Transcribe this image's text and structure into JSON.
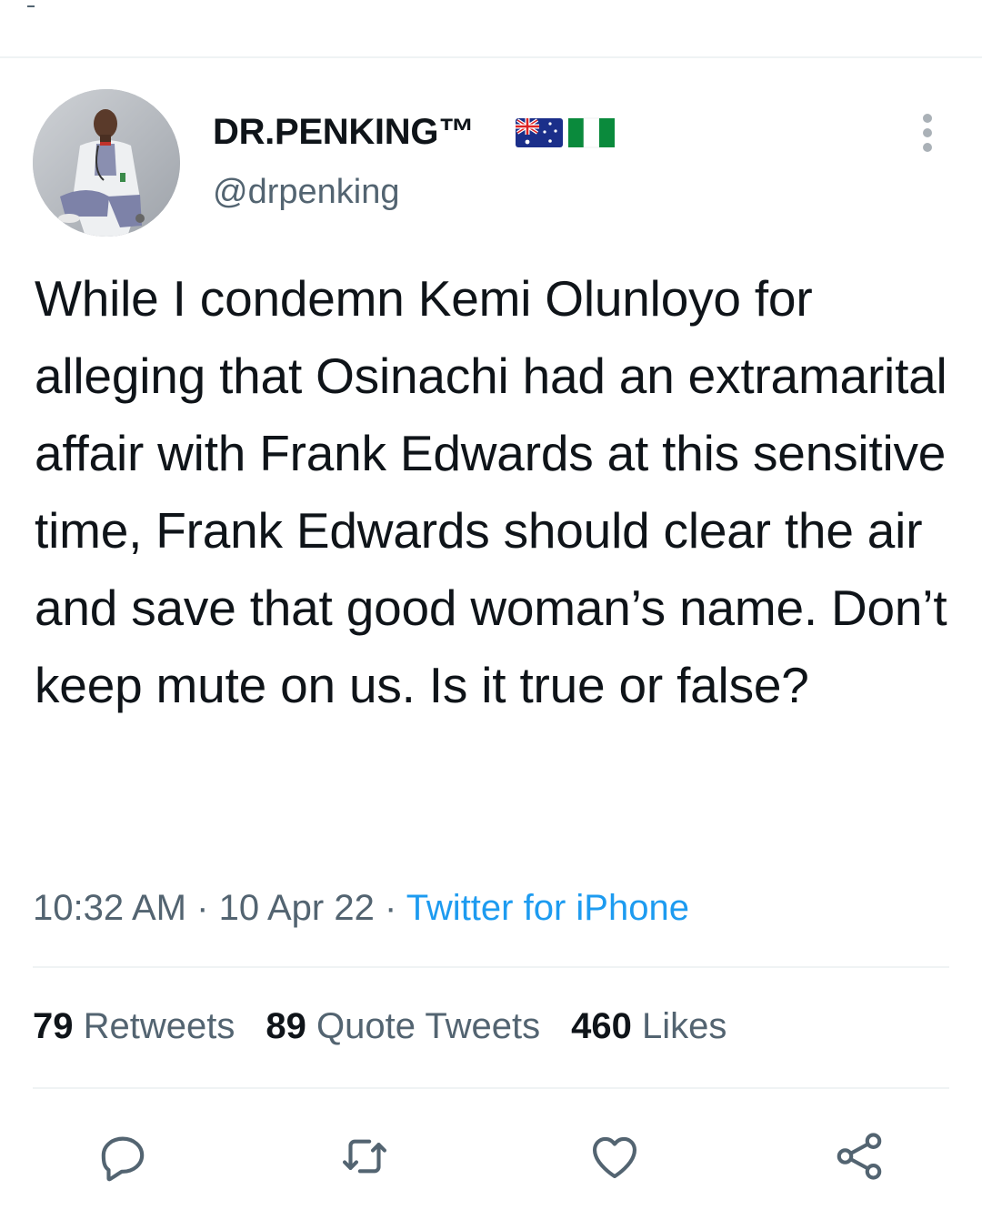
{
  "tweet": {
    "author": {
      "display_name": "DR.PENKING™",
      "handle": "@drpenking",
      "flags": [
        "australia-flag",
        "nigeria-flag"
      ]
    },
    "text": "While I condemn Kemi Olunloyo for alleging that Osinachi had an extramarital affair with Frank Edwards at this sensitive time, Frank Edwards should clear the air and save that good woman’s name. Don’t keep mute on us. Is it true or false?",
    "time": "10:32 AM",
    "date": "10 Apr 22",
    "source": "Twitter for iPhone",
    "separator": "·"
  },
  "stats": {
    "retweets": {
      "count": "79",
      "label": "Retweets"
    },
    "quote_tweets": {
      "count": "89",
      "label": "Quote Tweets"
    },
    "likes": {
      "count": "460",
      "label": "Likes"
    }
  },
  "actions": [
    "reply-icon",
    "retweet-icon",
    "like-icon",
    "share-icon"
  ],
  "colors": {
    "text": "#0f1419",
    "secondary": "#536471",
    "link": "#1d9bf0",
    "divider": "#eff3f4"
  }
}
